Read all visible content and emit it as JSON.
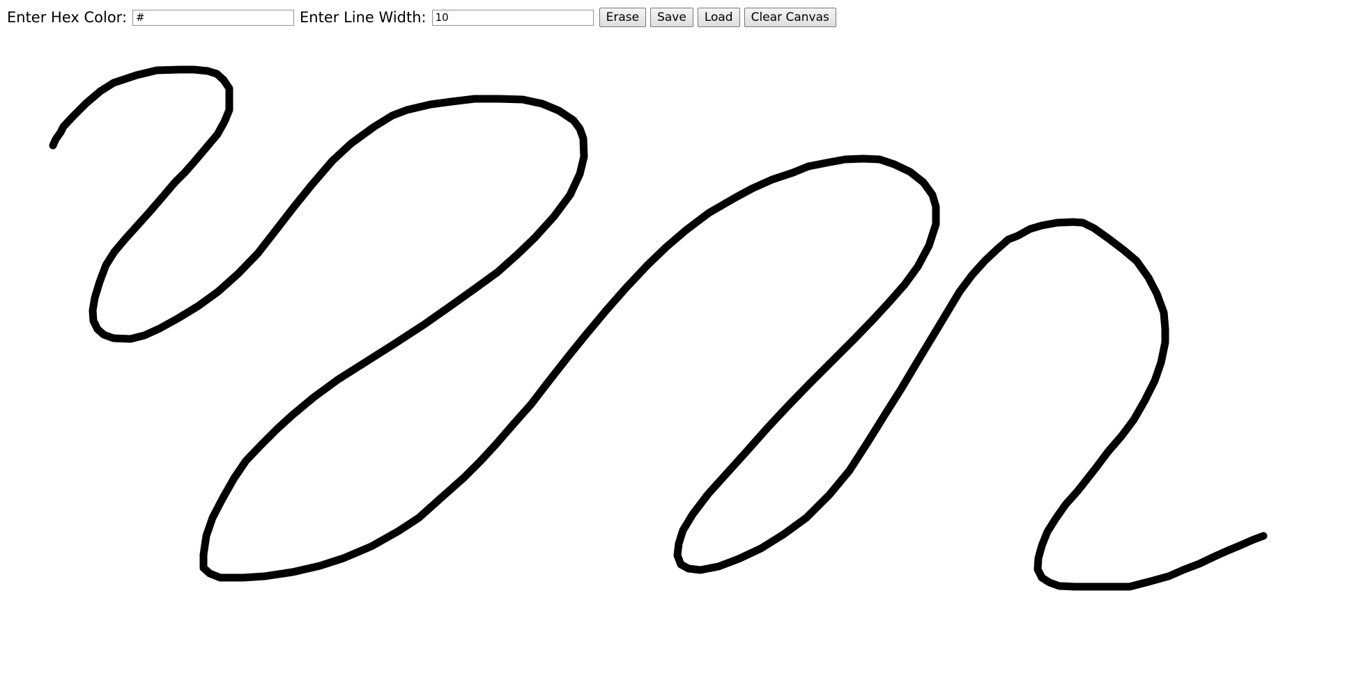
{
  "toolbar": {
    "hex_label": "Enter Hex Color:",
    "hex_value": "#",
    "width_label": "Enter Line Width:",
    "width_value": "10",
    "erase_label": "Erase",
    "save_label": "Save",
    "load_label": "Load",
    "clear_label": "Clear Canvas"
  },
  "canvas": {
    "stroke_color": "#000000",
    "background_color": "#ffffff"
  }
}
